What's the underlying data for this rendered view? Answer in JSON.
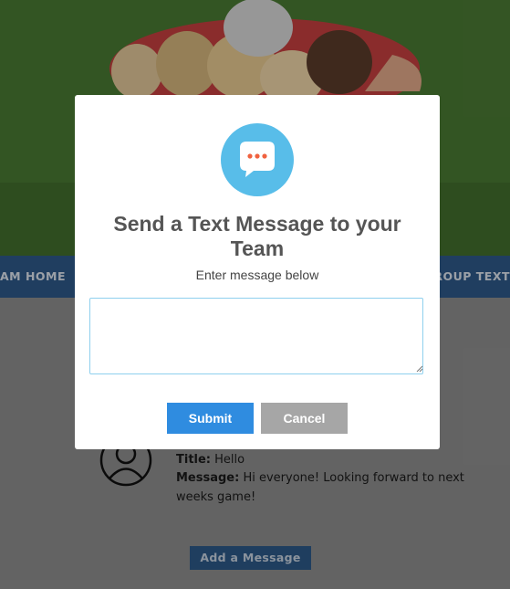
{
  "background": {
    "nav": {
      "left_label": "AM HOME",
      "right_label": "GROUP TEXT"
    },
    "message": {
      "title_label": "Title:",
      "title_value": "Hello",
      "message_label": "Message:",
      "message_value_line1": "Hi everyone! Looking forward to next",
      "message_value_line2": "weeks game!"
    },
    "add_button": "Add a Message"
  },
  "modal": {
    "icon": "chat-bubble-icon",
    "title": "Send a Text Message to your Team",
    "subtitle": "Enter message below",
    "textarea_value": "",
    "submit_label": "Submit",
    "cancel_label": "Cancel"
  },
  "colors": {
    "icon_circle": "#58bde9",
    "submit": "#2f8ce0",
    "cancel": "#a6a6a6",
    "navbar": "#2f5a8a"
  }
}
